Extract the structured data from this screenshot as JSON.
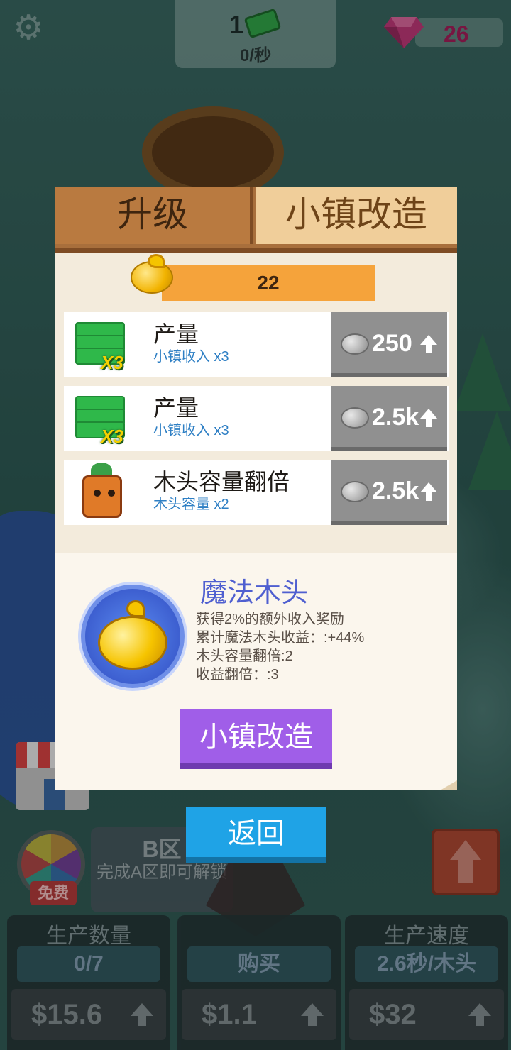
{
  "hud": {
    "money": "1",
    "rate": "0/秒",
    "gems": "26"
  },
  "background": {
    "free_badge": "免费",
    "zone_title": "B区",
    "zone_desc": "完成A区即可解锁",
    "stats": [
      {
        "label": "生产数量",
        "value": "0/7",
        "price": "$15.6"
      },
      {
        "label": "",
        "value": "购买",
        "price": "$1.1"
      },
      {
        "label": "生产速度",
        "value": "2.6秒/木头",
        "price": "$32"
      }
    ]
  },
  "modal": {
    "tabs": [
      {
        "label": "升级",
        "active": false
      },
      {
        "label": "小镇改造",
        "active": true
      }
    ],
    "magic_wood_count": "22",
    "upgrades": [
      {
        "title": "产量",
        "subtitle": "小镇收入 x3",
        "cost": "250",
        "icon": "cash-x3-icon"
      },
      {
        "title": "产量",
        "subtitle": "小镇收入 x3",
        "cost": "2.5k",
        "icon": "cash-x3-icon"
      },
      {
        "title": "木头容量翻倍",
        "subtitle": "木头容量 x2",
        "cost": "2.5k",
        "icon": "wood-character-icon"
      }
    ],
    "magic": {
      "title": "魔法木头",
      "lines": [
        "获得2%的额外收入奖励",
        "累计魔法木头收益：:+44%",
        "木头容量翻倍:2",
        "收益翻倍：:3"
      ]
    },
    "reform_button": "小镇改造",
    "x3_badge": "X3"
  },
  "back_button": "返回",
  "colors": {
    "tab_active": "#f0ce9a",
    "tab_inactive": "#b97a40",
    "counter_bar": "#f5a33b",
    "cost_button": "#909090",
    "reform_button": "#a05ee8",
    "back_button": "#1fa3e6",
    "magic_title": "#4f5fd0",
    "subtitle_blue": "#2e7fc4"
  }
}
